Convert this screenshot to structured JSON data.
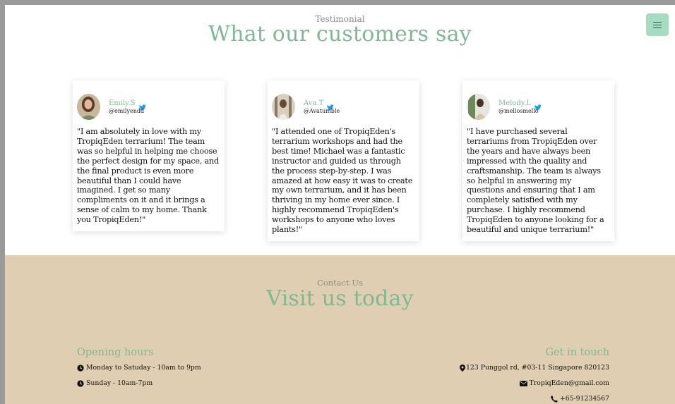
{
  "testimonials": {
    "eyebrow": "Testimonial",
    "title": "What our customers say",
    "cards": [
      {
        "name": "Emily.S",
        "handle": "@emilyendd",
        "quote": "\"I am absolutely in love with my TropiqEden terrarium! The team was so helpful in helping me choose the perfect design for my space, and the final product is even more beautiful than I could have imagined. I get so many compliments on it and it brings a sense of calm to my home. Thank you TropiqEden!\""
      },
      {
        "name": "Ava.T",
        "handle": "@Avatumble",
        "quote": "\"I attended one of TropiqEden's terrarium workshops and had the best time! Michael was a fantastic instructor and guided us through the process step-by-step. I was amazed at how easy it was to create my own terrarium, and it has been thriving in my home ever since. I highly recommend TropiqEden's workshops to anyone who loves plants!\""
      },
      {
        "name": "Melody.L",
        "handle": "@mellosmello",
        "quote": "\"I have purchased several terrariums from TropiqEden over the years and have always been impressed with the quality and craftsmanship. The team is always so helpful in answering my questions and ensuring that I am completely satisfied with my purchase. I highly recommend TropiqEden to anyone looking for a beautiful and unique terrarium!\""
      }
    ]
  },
  "contact": {
    "eyebrow": "Contact Us",
    "title": "Visit us today",
    "hours": {
      "title": "Opening hours",
      "lines": [
        "Monday to Satuday - 10am to 9pm",
        "Sunday - 10am-7pm"
      ]
    },
    "touch": {
      "title": "Get in touch",
      "address": "123 Punggol rd, #03-11 Singapore 820123",
      "email": "TropiqEden@gmail.com",
      "phone": "+65-91234567"
    }
  },
  "icons": {
    "menu": "hamburger-menu-icon",
    "twitter": "twitter-bird-icon",
    "clock": "clock-icon",
    "location": "map-marker-icon",
    "email": "envelope-icon",
    "phone": "phone-icon"
  },
  "colors": {
    "accent_green": "#7fb893",
    "menu_button": "#a5dcc2",
    "contact_bg": "#e0ceb2",
    "twitter_blue": "#1d9bf0"
  }
}
